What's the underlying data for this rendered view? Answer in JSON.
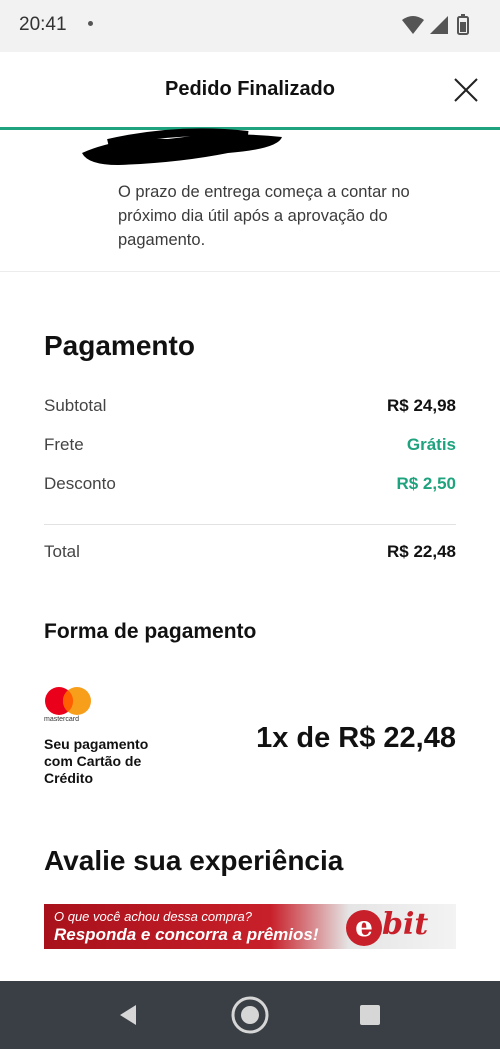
{
  "status_bar": {
    "time": "20:41"
  },
  "header": {
    "title": "Pedido Finalizado"
  },
  "delivery": {
    "note": "O prazo de entrega começa a contar no próximo dia útil após a aprovação do pagamento."
  },
  "payment": {
    "title": "Pagamento",
    "rows": [
      {
        "label": "Subtotal",
        "value": "R$ 24,98"
      },
      {
        "label": "Frete",
        "value": "Grátis"
      },
      {
        "label": "Desconto",
        "value": "R$ 2,50"
      }
    ],
    "total": {
      "label": "Total",
      "value": "R$ 22,48"
    }
  },
  "payment_method": {
    "title": "Forma de pagamento",
    "card_brand": "mastercard",
    "description": "Seu pagamento com Cartão de Crédito",
    "installments": "1x de R$ 22,48"
  },
  "rating": {
    "title": "Avalie sua experiência",
    "banner_line1": "O que você achou dessa compra?",
    "banner_line2": "Responda e concorra a prêmios!",
    "brand_e": "e",
    "brand_rest": "bit"
  },
  "colors": {
    "accent_green": "#1fa37f",
    "ebit_red": "#c8202a",
    "nav_bar": "#3a3f45"
  }
}
